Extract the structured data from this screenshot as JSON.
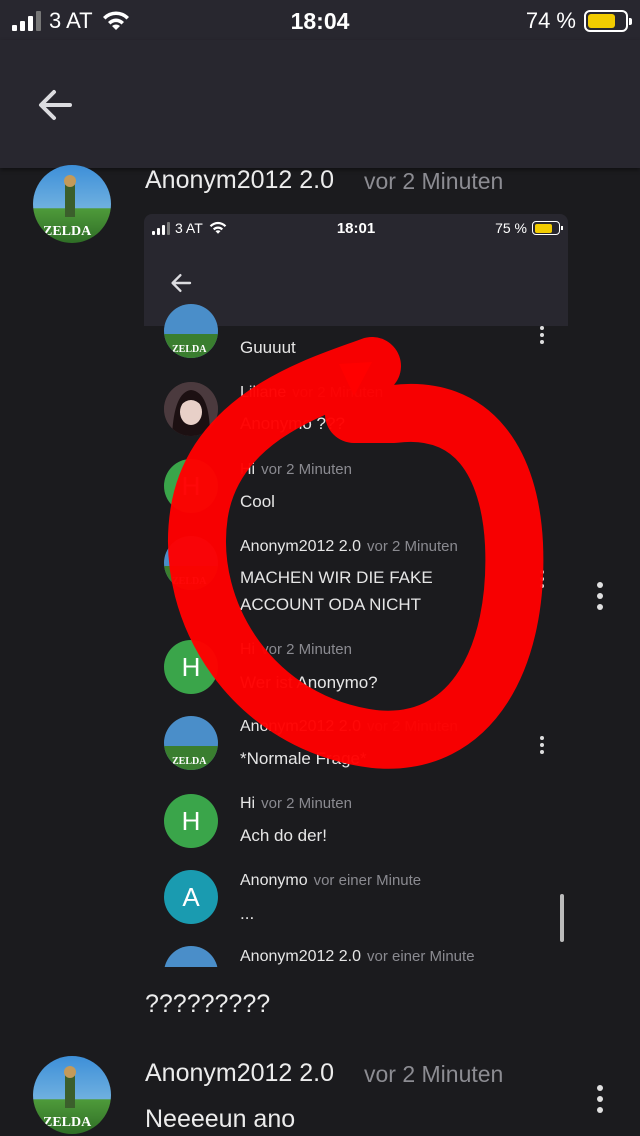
{
  "status_bar": {
    "carrier": "3 AT",
    "time": "18:04",
    "battery_percent": "74 %",
    "battery_level": 0.74,
    "signal_bars": 3,
    "signal_total": 4
  },
  "app_bar": {
    "back_icon": "arrow-left-icon"
  },
  "posts": [
    {
      "author": "Anonym2012 2.0",
      "time": "vor 2 Minuten",
      "avatar": "zelda-avatar"
    },
    {
      "text": "?????????"
    },
    {
      "author": "Anonym2012 2.0",
      "time": "vor 2 Minuten",
      "text": "Neeeeun ano",
      "avatar": "zelda-avatar"
    }
  ],
  "embedded_screenshot": {
    "status": {
      "carrier": "3 AT",
      "time": "18:01",
      "battery_percent": "75 %",
      "battery_level": 0.75
    },
    "messages": [
      {
        "author": "",
        "time": "",
        "text": "Guuuut",
        "avatar": "zelda"
      },
      {
        "author": "Liliane",
        "time": "vor 2 Minuten",
        "text": "Anonymo ???",
        "avatar": "anime"
      },
      {
        "author": "Hi",
        "time": "vor 2 Minuten",
        "text": "Cool",
        "avatar": "H"
      },
      {
        "author": "Anonym2012 2.0",
        "time": "vor 2 Minuten",
        "text": "MACHEN WIR DIE FAKE ACCOUNT ODA NICHT",
        "avatar": "zelda"
      },
      {
        "author": "Hi",
        "time": "vor 2 Minuten",
        "text": "Wer ist Anonymo?",
        "avatar": "H"
      },
      {
        "author": "Anonym2012 2.0",
        "time": "vor 2 Minuten",
        "text": "*Normale Frage*",
        "avatar": "zelda"
      },
      {
        "author": "Hi",
        "time": "vor 2 Minuten",
        "text": "Ach do der!",
        "avatar": "H"
      },
      {
        "author": "Anonymo",
        "time": "vor einer Minute",
        "text": "...",
        "avatar": "A"
      },
      {
        "author": "Anonym2012 2.0",
        "time": "vor einer Minute",
        "text": "",
        "avatar": "zelda"
      }
    ]
  },
  "colors": {
    "background": "#1b1b1e",
    "app_bar": "#28272f",
    "avatar_green": "#3aa54a",
    "avatar_teal": "#1a9bb0",
    "annotation_red": "#ff0000"
  }
}
